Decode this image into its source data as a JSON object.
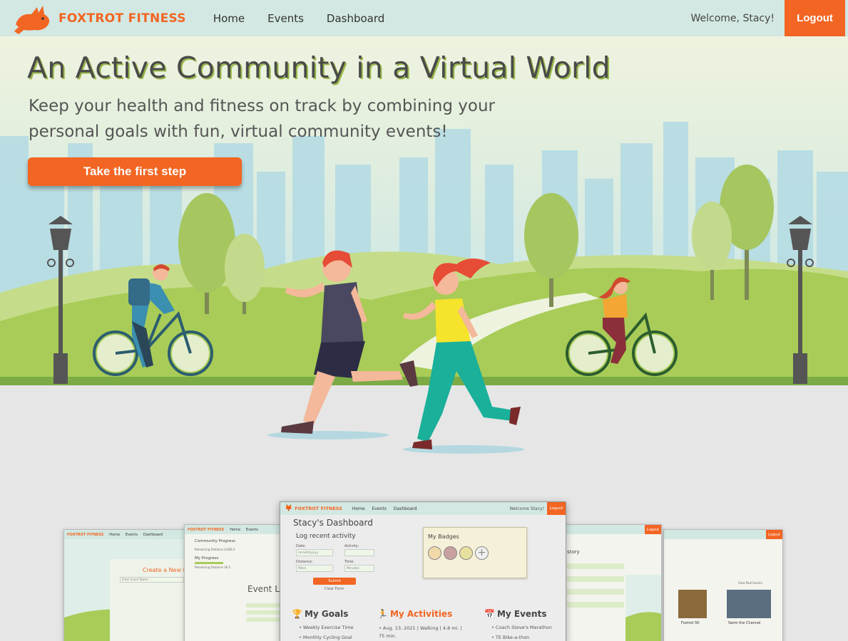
{
  "nav": {
    "brand": "FOXTROT FITNESS",
    "links": [
      "Home",
      "Events",
      "Dashboard"
    ],
    "welcome": "Welcome, Stacy!",
    "logout": "Logout"
  },
  "hero": {
    "title": "An Active Community in a Virtual World",
    "subtitle": "Keep your health and fitness on track by combining your personal goals with fun, virtual community events!",
    "cta": "Take the first step"
  },
  "dashboard_preview": {
    "brand": "FOXTROT FITNESS",
    "links": [
      "Home",
      "Events",
      "Dashboard"
    ],
    "welcome": "Welcome Stacy!",
    "logout": "Logout",
    "title": "Stacy's Dashboard",
    "log_title": "Log recent activity",
    "date_label": "Date:",
    "date_placeholder": "mm/dd/yyyy",
    "activity_label": "Activity:",
    "distance_label": "Distance:",
    "distance_placeholder": "Miles",
    "time_label": "Time:",
    "time_placeholder": "Minutes",
    "submit": "Submit",
    "clear": "Clear Form",
    "badges_title": "My Badges",
    "goals_title": "My Goals",
    "goals": [
      "Weekly Exercise Time",
      "Monthly Cycling Goal"
    ],
    "activities_title": "My Activities",
    "activities": [
      "Aug. 13, 2021 | Walking | 4.8 mi. | 75 min."
    ],
    "events_title": "My Events",
    "events": [
      "Coach Steve's Marathon",
      "TE Bike-a-thon"
    ]
  },
  "side_previews": {
    "create_event": "Create a New E",
    "event_name": "Enter Event Name",
    "community_progress": "Community Progress",
    "remaining_1": "Remaining Distance 4,826.5",
    "my_progress": "My Progress",
    "remaining_2": "Remaining Distance 36.5",
    "event_list": "Event L",
    "history": "story",
    "foxtrot_5k": "Foxtrot 5K",
    "swim_channel": "Swim the Channel",
    "view_all": "View Past Events"
  },
  "colors": {
    "accent": "#f26522",
    "nav_bg": "#d3e8e2",
    "title_shadow": "#9ab84a"
  }
}
